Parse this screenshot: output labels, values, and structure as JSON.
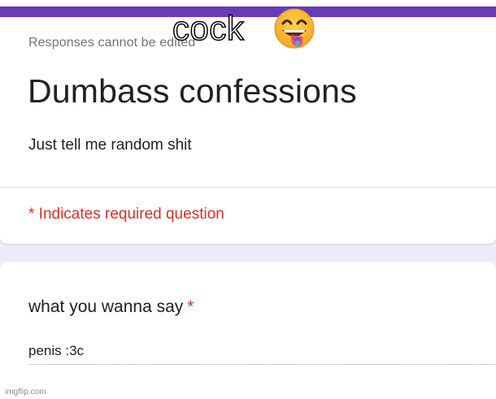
{
  "form": {
    "readonly_note": "Responses cannot be edited",
    "title": "Dumbass confessions",
    "description": "Just tell me random shit",
    "required_note": "* Indicates required question",
    "accent_color": "#673ab7"
  },
  "question": {
    "title": "what you wanna say",
    "required_mark": "*",
    "answer": "penis :3c"
  },
  "overlay": {
    "caption": "cock",
    "emoji_icon": "face-savoring-food-icon"
  },
  "watermark": "imgflip.com"
}
